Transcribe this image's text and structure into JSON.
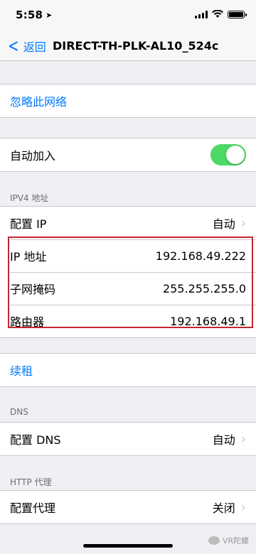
{
  "status_bar": {
    "time": "5:58",
    "location_icon": "location-arrow-icon",
    "wifi_icon": "wifi-icon",
    "battery_level": 1.0
  },
  "nav": {
    "back_label": "返回",
    "title": "DIRECT-TH-PLK-AL10_524c"
  },
  "forget_network": "忽略此网络",
  "auto_join": {
    "label": "自动加入",
    "enabled": true,
    "toggle_color": "#4cd964"
  },
  "ipv4": {
    "header": "IPV4 地址",
    "configure_ip": {
      "label": "配置 IP",
      "value": "自动"
    },
    "ip_address": {
      "label": "IP 地址",
      "value": "192.168.49.222"
    },
    "subnet_mask": {
      "label": "子网掩码",
      "value": "255.255.255.0"
    },
    "router": {
      "label": "路由器",
      "value": "192.168.49.1"
    },
    "highlight_color": "#c2272d"
  },
  "renew_lease": "续租",
  "dns": {
    "header": "DNS",
    "configure_dns": {
      "label": "配置 DNS",
      "value": "自动"
    }
  },
  "http_proxy": {
    "header": "HTTP 代理",
    "configure_proxy": {
      "label": "配置代理",
      "value": "关闭"
    }
  },
  "watermark": "VR陀螺",
  "accent_color": "#007aff"
}
